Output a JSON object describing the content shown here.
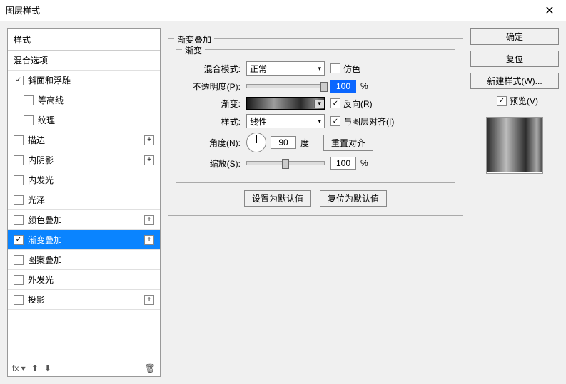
{
  "title": "图层样式",
  "styles_header": "样式",
  "style_items": [
    {
      "label": "混合选项",
      "chk": "none",
      "plus": false,
      "sub": false
    },
    {
      "label": "斜面和浮雕",
      "chk": "checked",
      "plus": false,
      "sub": false
    },
    {
      "label": "等高线",
      "chk": "unchecked",
      "plus": false,
      "sub": true
    },
    {
      "label": "纹理",
      "chk": "unchecked",
      "plus": false,
      "sub": true
    },
    {
      "label": "描边",
      "chk": "unchecked",
      "plus": true,
      "sub": false
    },
    {
      "label": "内阴影",
      "chk": "unchecked",
      "plus": true,
      "sub": false
    },
    {
      "label": "内发光",
      "chk": "unchecked",
      "plus": false,
      "sub": false
    },
    {
      "label": "光泽",
      "chk": "unchecked",
      "plus": false,
      "sub": false
    },
    {
      "label": "颜色叠加",
      "chk": "unchecked",
      "plus": true,
      "sub": false
    },
    {
      "label": "渐变叠加",
      "chk": "checked",
      "plus": true,
      "sub": false,
      "selected": true
    },
    {
      "label": "图案叠加",
      "chk": "unchecked",
      "plus": false,
      "sub": false
    },
    {
      "label": "外发光",
      "chk": "unchecked",
      "plus": false,
      "sub": false
    },
    {
      "label": "投影",
      "chk": "unchecked",
      "plus": true,
      "sub": false
    }
  ],
  "section": {
    "title": "渐变叠加",
    "subtitle": "渐变",
    "blend_label": "混合模式:",
    "blend_value": "正常",
    "dither_label": "仿色",
    "opacity_label": "不透明度(P):",
    "opacity_value": "100",
    "opacity_unit": "%",
    "gradient_label": "渐变:",
    "reverse_label": "反向(R)",
    "style_label": "样式:",
    "style_value": "线性",
    "align_label": "与图层对齐(I)",
    "angle_label": "角度(N):",
    "angle_value": "90",
    "angle_unit": "度",
    "realign_btn": "重置对齐",
    "scale_label": "缩放(S):",
    "scale_value": "100",
    "scale_unit": "%",
    "make_default": "设置为默认值",
    "reset_default": "复位为默认值"
  },
  "right": {
    "ok": "确定",
    "cancel": "复位",
    "new_style": "新建样式(W)...",
    "preview": "预览(V)"
  },
  "footer": {
    "fx": "fx ▾",
    "up": "⬆",
    "down": "⬇",
    "trash": "🗑"
  }
}
